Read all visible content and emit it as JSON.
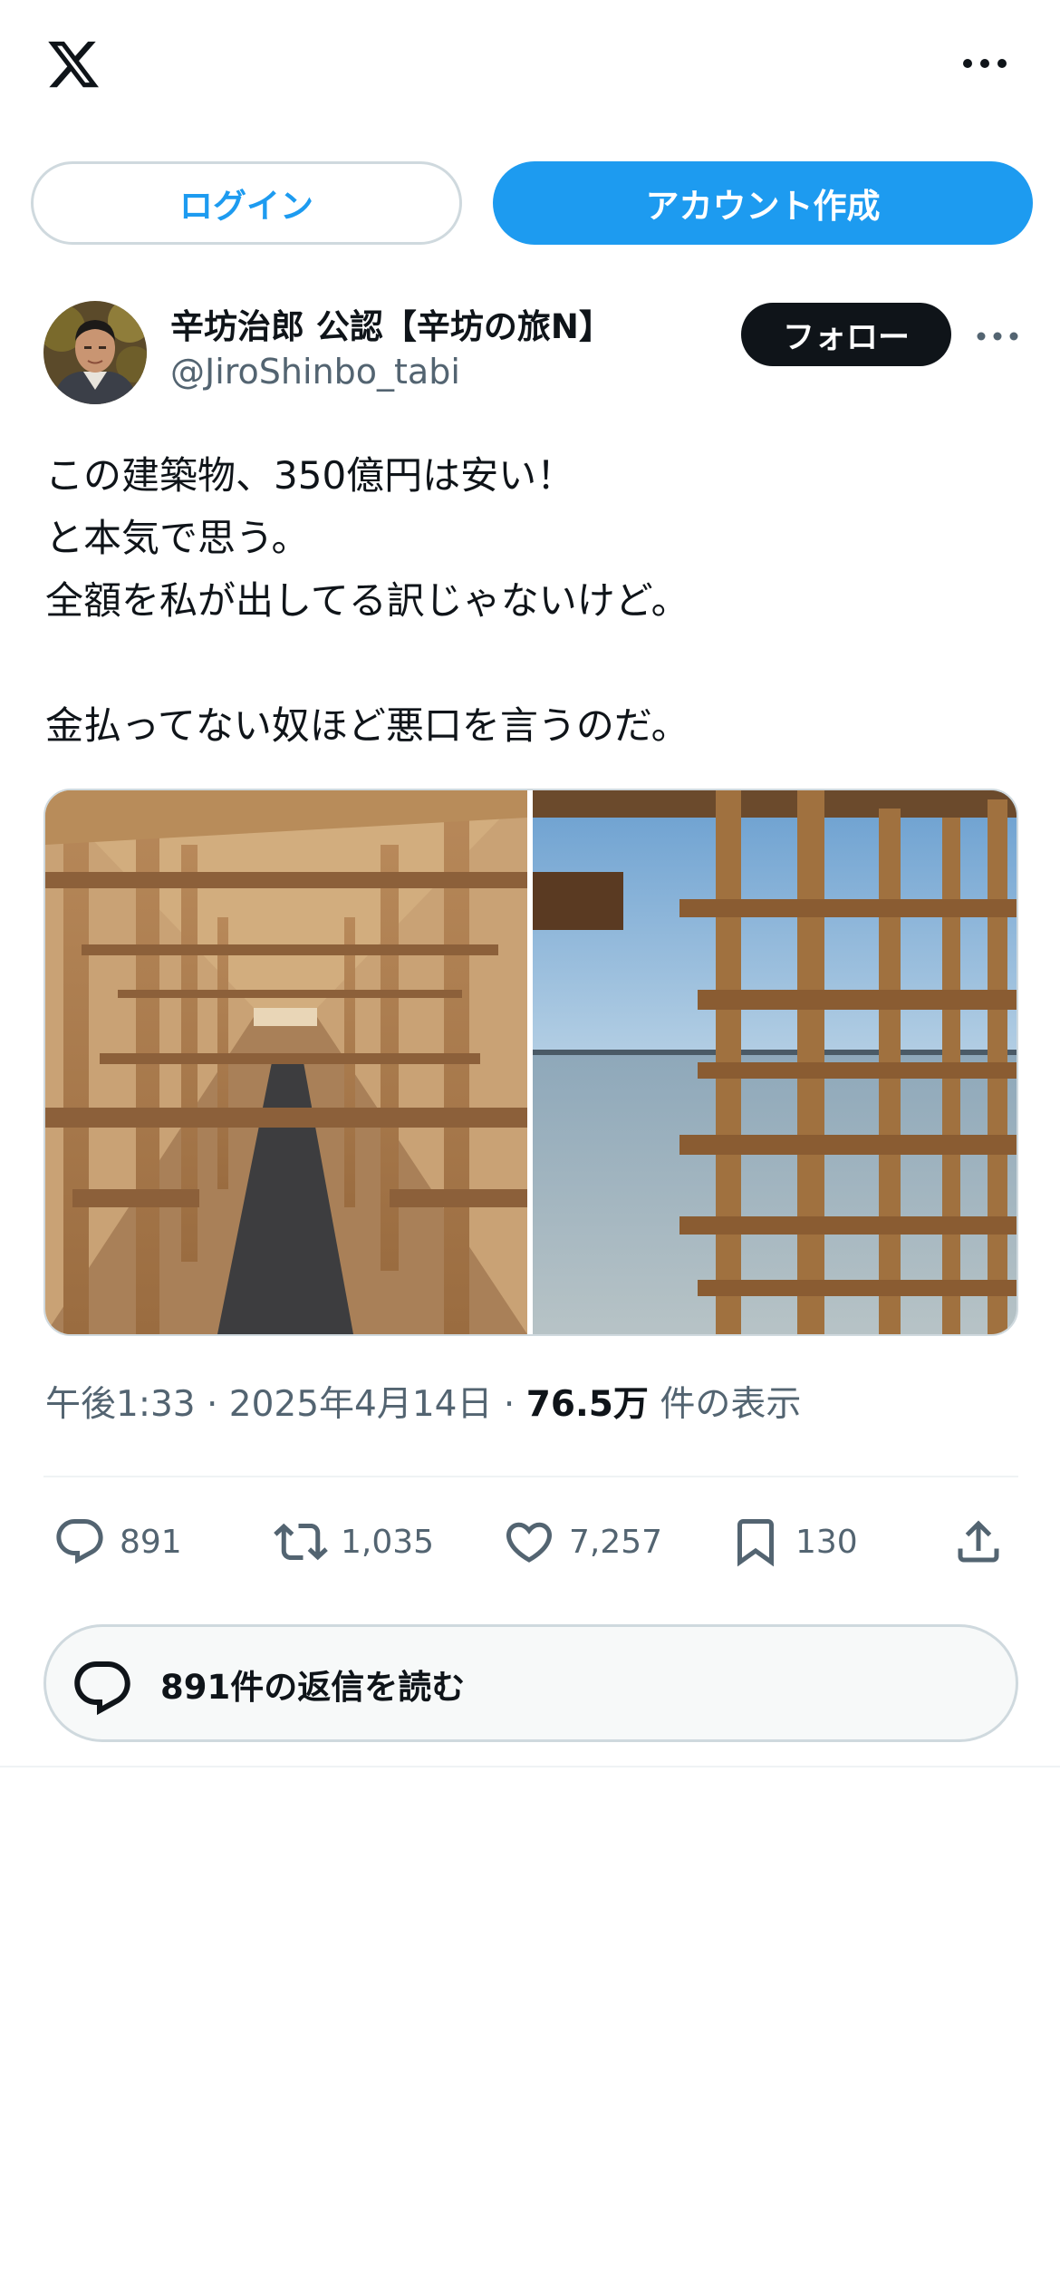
{
  "header": {
    "logo_icon": "x-logo-icon",
    "more_icon": "more-horizontal-icon"
  },
  "auth": {
    "login_label": "ログイン",
    "signup_label": "アカウント作成"
  },
  "author": {
    "display_name": "辛坊治郎 公認【辛坊の旅N】",
    "handle": "@JiroShinbo_tabi",
    "follow_label": "フォロー"
  },
  "tweet": {
    "lines": [
      "この建築物、350億円は安い！",
      "と本気で思う。",
      "全額を私が出してる訳じゃないけど。",
      "",
      "金払ってない奴ほど悪口を言うのだ。"
    ],
    "time": "午後1:33",
    "sep1": " · ",
    "date": "2025年4月14日",
    "sep2": " · ",
    "views": "76.5万",
    "views_suffix": " 件の表示"
  },
  "actions": {
    "reply_count": "891",
    "retweet_count": "1,035",
    "like_count": "7,257",
    "bookmark_count": "130"
  },
  "replies_button": {
    "label": "891件の返信を読む"
  },
  "colors": {
    "accent": "#1d9bf0",
    "text_primary": "#0f1419",
    "text_secondary": "#536471",
    "border": "#cfd9de"
  }
}
